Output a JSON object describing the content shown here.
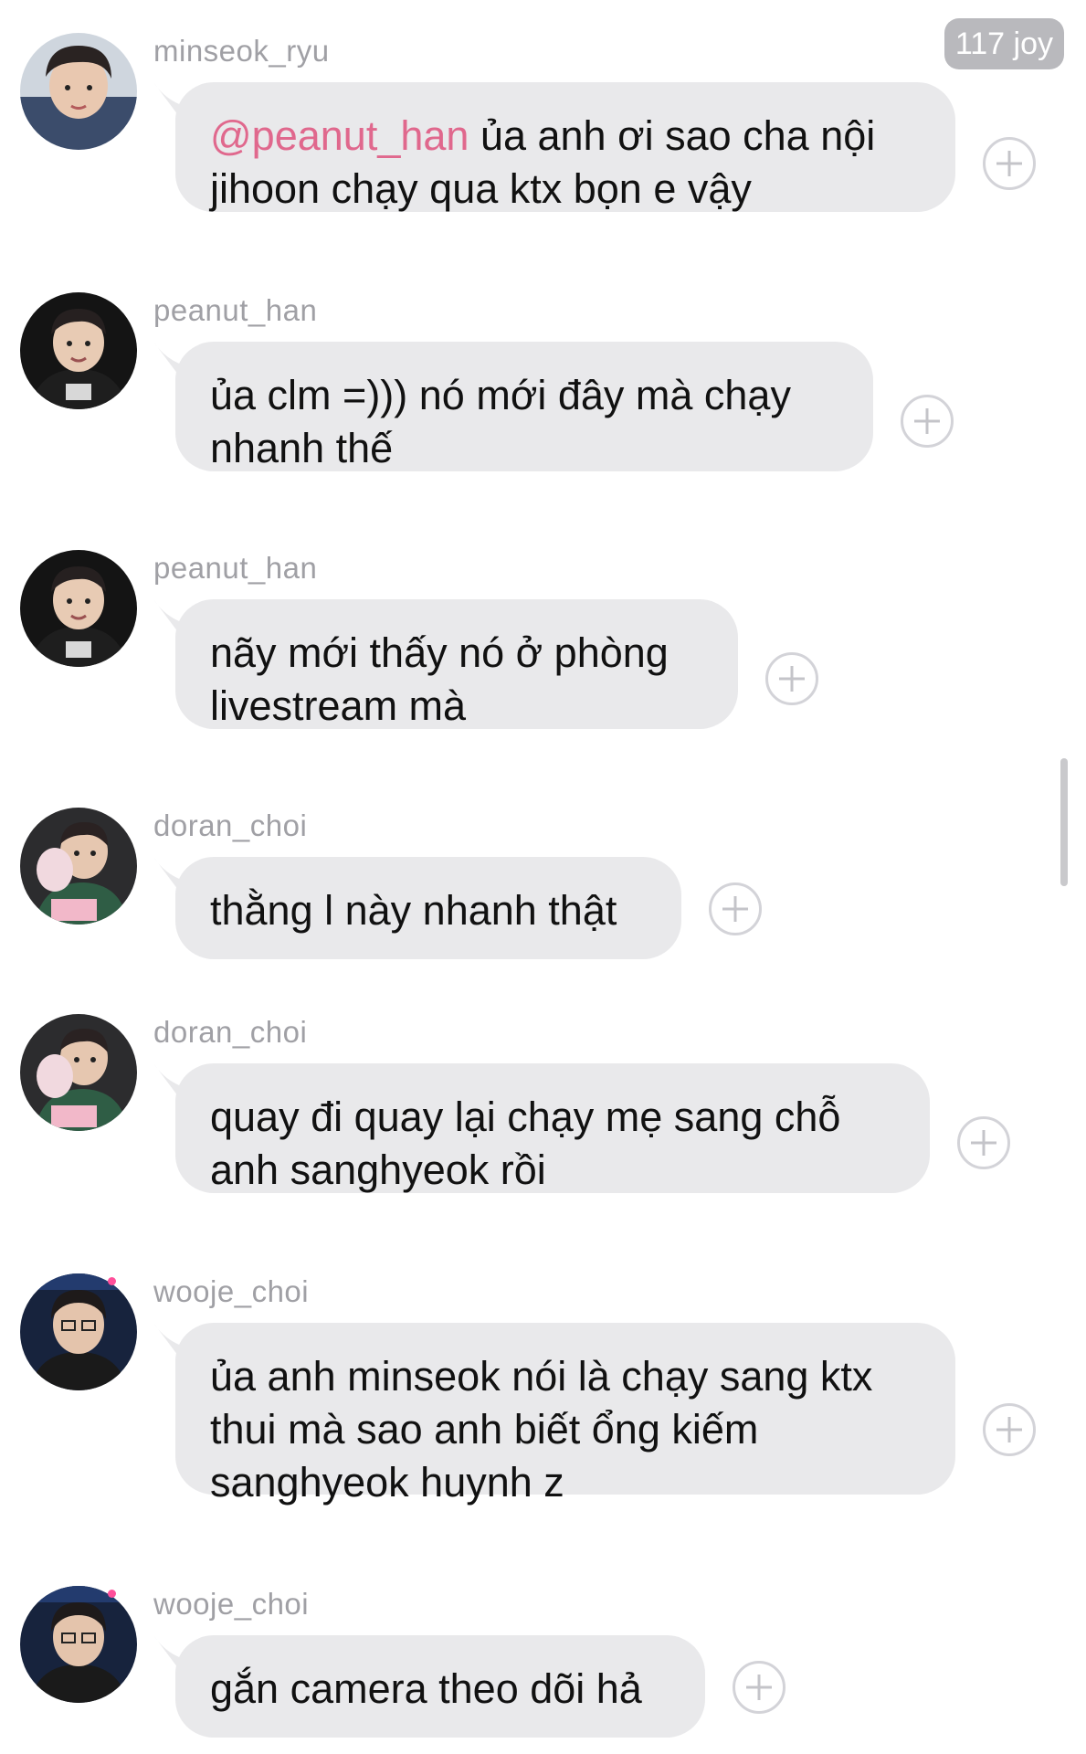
{
  "badge": "117 joy",
  "messages": [
    {
      "username": "minseok_ryu",
      "mention": "@peanut_han",
      "text": " ủa anh ơi sao cha nội jihoon chạy qua ktx bọn e vậy",
      "avatar_icon": "user-avatar-minseok-icon"
    },
    {
      "username": "peanut_han",
      "mention": "",
      "text": "ủa clm =))) nó mới đây mà chạy nhanh thế",
      "avatar_icon": "user-avatar-peanut-icon"
    },
    {
      "username": "peanut_han",
      "mention": "",
      "text": "nãy mới thấy nó ở phòng livestream mà",
      "avatar_icon": "user-avatar-peanut-icon"
    },
    {
      "username": "doran_choi",
      "mention": "",
      "text": "thằng l này nhanh thật",
      "avatar_icon": "user-avatar-doran-icon"
    },
    {
      "username": "doran_choi",
      "mention": "",
      "text": "quay đi quay lại chạy mẹ sang chỗ anh sanghyeok rồi",
      "avatar_icon": "user-avatar-doran-icon"
    },
    {
      "username": "wooje_choi",
      "mention": "",
      "text": "ủa anh minseok nói là chạy sang ktx thui mà sao anh biết ổng kiếm sanghyeok huynh z",
      "avatar_icon": "user-avatar-wooje-icon"
    },
    {
      "username": "wooje_choi",
      "mention": "",
      "text": "gắn camera theo dõi hả",
      "avatar_icon": "user-avatar-wooje-icon"
    }
  ],
  "colors": {
    "bubble": "#e9e9eb",
    "mention": "#e0688d",
    "username": "#a0a0a5",
    "badge": "#b9b9bd"
  },
  "react_icon": "add-reaction-icon"
}
